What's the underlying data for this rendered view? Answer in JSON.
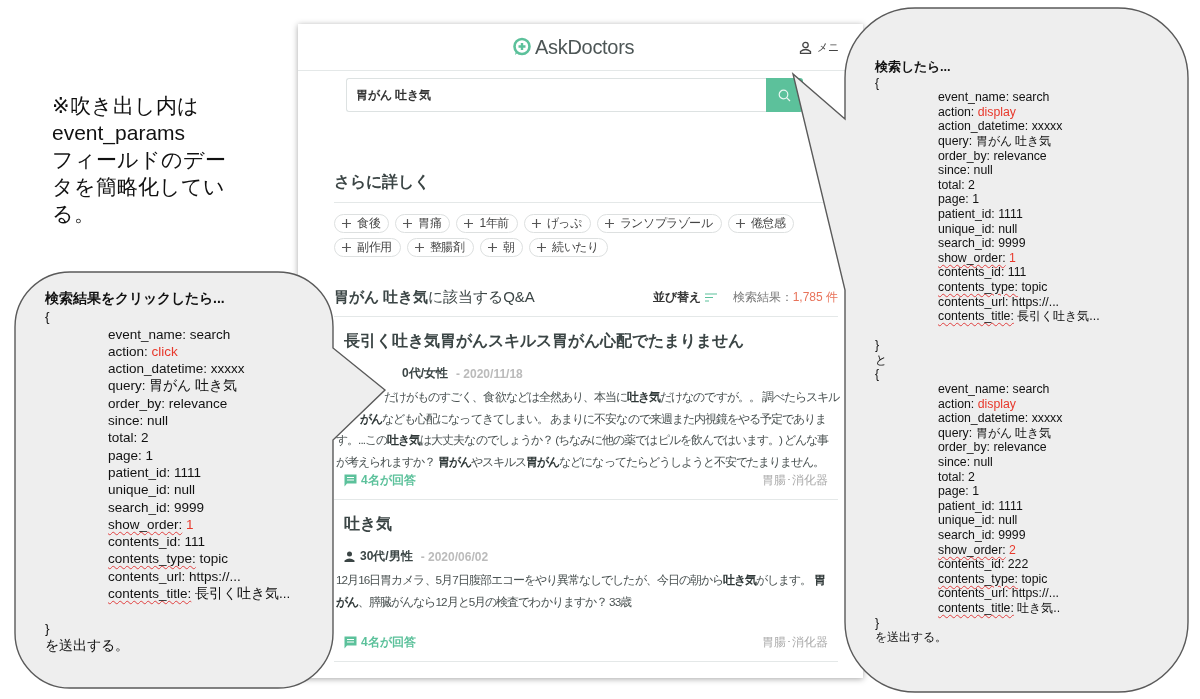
{
  "note": "※吹き出し内は event_params\nフィールドのデータを簡略化している。",
  "site": {
    "logo": "AskDoctors",
    "menu": "メニ",
    "search": {
      "value": "胃がん 吐き気"
    }
  },
  "refine": {
    "title": "さらに詳しく",
    "chips": [
      "食後",
      "胃痛",
      "1年前",
      "げっぷ",
      "ランソプラゾール",
      "倦怠感",
      "副作用",
      "整腸剤",
      "朝",
      "続いたり"
    ]
  },
  "results": {
    "heading": "**胃がん 吐き気**に該当するQ&A",
    "sort": "並び替え",
    "count_label": "検索結果：",
    "count": "1,785 件",
    "items": [
      {
        "title": "長引く吐き気胃がんスキルス胃がん心配でたまりません",
        "author": "0代/女性",
        "date": "- 2020/11/18",
        "body": [
          "だけがものすごく、食欲などは全然あり、本当に**吐き気**だけなのですが。。 調べたらスキル",
          "**がん**なども心配になってきてしまい。 あまりに不安なので来週また内視鏡をやる予定でありま",
          "す。...この**吐き気**は大丈夫なのでしょうか？ (ちなみに他の薬ではピルを飲んではいます。) どんな事",
          "が考えられますか？ **胃がん**やスキルス**胃がん**などになってたらどうしようと不安でたまりません。"
        ],
        "answers": "4名が回答",
        "category": "胃腸･消化器"
      },
      {
        "title": "吐き気",
        "author": "30代/男性",
        "date": "- 2020/06/02",
        "body": [
          "12月16日胃カメラ、5月7日腹部エコーをやり異常なしでしたが、今日の朝から**吐き気**がします。 **胃**",
          "**がん**、膵臓がんなら12月と5月の検査でわかりますか？ 33歳"
        ],
        "answers": "4名が回答",
        "category": "胃腸･消化器"
      }
    ]
  },
  "callouts": [
    {
      "lines": [
        {
          "kind": "heading",
          "text": "検索結果をクリックしたら..."
        },
        {
          "kind": "brace",
          "text": "{"
        },
        {
          "kind": "param",
          "key": "event_name:",
          "value": "search",
          "highlight": false,
          "flagged": false
        },
        {
          "kind": "param",
          "key": "action:",
          "value": "click",
          "highlight": true,
          "flagged": false
        },
        {
          "kind": "param",
          "key": "action_datetime:",
          "value": "xxxxx",
          "highlight": false,
          "flagged": false
        },
        {
          "kind": "param",
          "key": "query:",
          "value": "胃がん 吐き気",
          "highlight": false,
          "flagged": false
        },
        {
          "kind": "param",
          "key": "order_by:",
          "value": "relevance",
          "highlight": false,
          "flagged": false
        },
        {
          "kind": "param",
          "key": "since:",
          "value": "null",
          "highlight": false,
          "flagged": false
        },
        {
          "kind": "param",
          "key": "total:",
          "value": "2",
          "highlight": false,
          "flagged": false
        },
        {
          "kind": "param",
          "key": "page:",
          "value": "1",
          "highlight": false,
          "flagged": false
        },
        {
          "kind": "param",
          "key": "patient_id:",
          "value": "1111",
          "highlight": false,
          "flagged": false
        },
        {
          "kind": "param",
          "key": "unique_id:",
          "value": "null",
          "highlight": false,
          "flagged": false
        },
        {
          "kind": "param",
          "key": "search_id:",
          "value": "9999",
          "highlight": false,
          "flagged": false
        },
        {
          "kind": "param",
          "key": "show_order:",
          "value": "1",
          "highlight": true,
          "flagged": true
        },
        {
          "kind": "param",
          "key": "contents_id:",
          "value": "111",
          "highlight": false,
          "flagged": false
        },
        {
          "kind": "param",
          "key": "contents_type:",
          "value": "topic",
          "highlight": false,
          "flagged": true
        },
        {
          "kind": "param",
          "key": "contents_url:",
          "value": "https://...",
          "highlight": false,
          "flagged": false
        },
        {
          "kind": "param",
          "key": "contents_title:",
          "value": "長引く吐き気...",
          "highlight": false,
          "flagged": true
        },
        {
          "kind": "gap"
        },
        {
          "kind": "brace",
          "text": "}"
        },
        {
          "kind": "text",
          "text": "を送出する。"
        }
      ]
    },
    {
      "lines": [
        {
          "kind": "heading",
          "text": "検索したら..."
        },
        {
          "kind": "brace",
          "text": "{"
        },
        {
          "kind": "param",
          "key": "event_name:",
          "value": "search",
          "highlight": false,
          "flagged": false
        },
        {
          "kind": "param",
          "key": "action:",
          "value": "display",
          "highlight": true,
          "flagged": false
        },
        {
          "kind": "param",
          "key": "action_datetime:",
          "value": "xxxxx",
          "highlight": false,
          "flagged": false
        },
        {
          "kind": "param",
          "key": "query:",
          "value": "胃がん 吐き気",
          "highlight": false,
          "flagged": false
        },
        {
          "kind": "param",
          "key": "order_by:",
          "value": "relevance",
          "highlight": false,
          "flagged": false
        },
        {
          "kind": "param",
          "key": "since:",
          "value": "null",
          "highlight": false,
          "flagged": false
        },
        {
          "kind": "param",
          "key": "total:",
          "value": "2",
          "highlight": false,
          "flagged": false
        },
        {
          "kind": "param",
          "key": "page:",
          "value": "1",
          "highlight": false,
          "flagged": false
        },
        {
          "kind": "param",
          "key": "patient_id:",
          "value": "1111",
          "highlight": false,
          "flagged": false
        },
        {
          "kind": "param",
          "key": "unique_id:",
          "value": "null",
          "highlight": false,
          "flagged": false
        },
        {
          "kind": "param",
          "key": "search_id:",
          "value": "9999",
          "highlight": false,
          "flagged": false
        },
        {
          "kind": "param",
          "key": "show_order:",
          "value": "1",
          "highlight": true,
          "flagged": true
        },
        {
          "kind": "param",
          "key": "contents_id:",
          "value": "111",
          "highlight": false,
          "flagged": false
        },
        {
          "kind": "param",
          "key": "contents_type:",
          "value": "topic",
          "highlight": false,
          "flagged": true
        },
        {
          "kind": "param",
          "key": "contents_url:",
          "value": "https://...",
          "highlight": false,
          "flagged": false
        },
        {
          "kind": "param",
          "key": "contents_title:",
          "value": "長引く吐き気...",
          "highlight": false,
          "flagged": true
        },
        {
          "kind": "gap"
        },
        {
          "kind": "brace",
          "text": "}"
        },
        {
          "kind": "text",
          "text": "と"
        },
        {
          "kind": "brace",
          "text": "{"
        },
        {
          "kind": "param",
          "key": "event_name:",
          "value": "search",
          "highlight": false,
          "flagged": false
        },
        {
          "kind": "param",
          "key": "action:",
          "value": "display",
          "highlight": true,
          "flagged": false
        },
        {
          "kind": "param",
          "key": "action_datetime:",
          "value": "xxxxx",
          "highlight": false,
          "flagged": false
        },
        {
          "kind": "param",
          "key": "query:",
          "value": "胃がん 吐き気",
          "highlight": false,
          "flagged": false
        },
        {
          "kind": "param",
          "key": "order_by:",
          "value": "relevance",
          "highlight": false,
          "flagged": false
        },
        {
          "kind": "param",
          "key": "since:",
          "value": "null",
          "highlight": false,
          "flagged": false
        },
        {
          "kind": "param",
          "key": "total:",
          "value": "2",
          "highlight": false,
          "flagged": false
        },
        {
          "kind": "param",
          "key": "page:",
          "value": "1",
          "highlight": false,
          "flagged": false
        },
        {
          "kind": "param",
          "key": "patient_id:",
          "value": "1111",
          "highlight": false,
          "flagged": false
        },
        {
          "kind": "param",
          "key": "unique_id:",
          "value": "null",
          "highlight": false,
          "flagged": false
        },
        {
          "kind": "param",
          "key": "search_id:",
          "value": "9999",
          "highlight": false,
          "flagged": false
        },
        {
          "kind": "param",
          "key": "show_order:",
          "value": "2",
          "highlight": true,
          "flagged": true
        },
        {
          "kind": "param",
          "key": "contents_id:",
          "value": "222",
          "highlight": false,
          "flagged": false
        },
        {
          "kind": "param",
          "key": "contents_type:",
          "value": "topic",
          "highlight": false,
          "flagged": true
        },
        {
          "kind": "param",
          "key": "contents_url:",
          "value": "https://...",
          "highlight": false,
          "flagged": false
        },
        {
          "kind": "param",
          "key": "contents_title:",
          "value": "吐き気..",
          "highlight": false,
          "flagged": true
        },
        {
          "kind": "brace",
          "text": "}"
        },
        {
          "kind": "text",
          "text": "を送出する。"
        }
      ]
    }
  ]
}
